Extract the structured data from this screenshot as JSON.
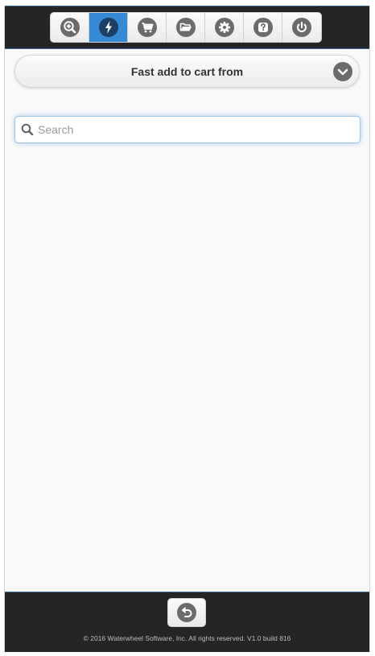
{
  "nav": {
    "items": [
      {
        "name": "zoom-search",
        "icon": "zoom-in-icon",
        "active": false
      },
      {
        "name": "fast-add",
        "icon": "lightning-icon",
        "active": true
      },
      {
        "name": "cart",
        "icon": "cart-icon",
        "active": false
      },
      {
        "name": "folder",
        "icon": "folder-open-icon",
        "active": false
      },
      {
        "name": "settings",
        "icon": "gear-icon",
        "active": false
      },
      {
        "name": "help",
        "icon": "help-icon",
        "active": false
      },
      {
        "name": "logout",
        "icon": "power-icon",
        "active": false
      }
    ]
  },
  "section": {
    "title": "Fast add to cart from",
    "icon": "chevron-down-icon"
  },
  "search": {
    "placeholder": "Search",
    "value": "",
    "icon": "search-icon"
  },
  "footer": {
    "back_icon": "back-arrow-icon",
    "copyright": "© 2016 Waterwheel Software, Inc. All rights reserved. V1.0 build 816"
  },
  "colors": {
    "header_bg": "#252525",
    "active_tab": "#3689d4",
    "icon_gray": "#6b6b6b",
    "focus_border": "#9cc3ea"
  }
}
